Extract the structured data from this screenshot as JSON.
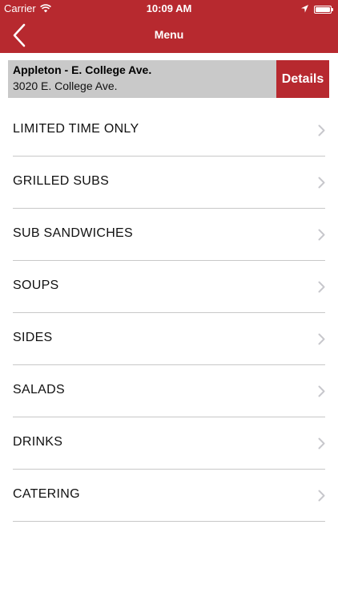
{
  "status_bar": {
    "carrier": "Carrier",
    "time": "10:09 AM",
    "wifi_icon": "wifi-icon",
    "location_icon": "location-arrow-icon",
    "battery_icon": "battery-icon"
  },
  "nav_bar": {
    "title": "Menu",
    "back_icon": "chevron-left-icon"
  },
  "store": {
    "name": "Appleton - E. College Ave.",
    "address": "3020 E. College Ave.",
    "details_label": "Details"
  },
  "menu": {
    "items": [
      {
        "label": "LIMITED TIME ONLY"
      },
      {
        "label": "GRILLED SUBS"
      },
      {
        "label": "SUB SANDWICHES"
      },
      {
        "label": "SOUPS"
      },
      {
        "label": "SIDES"
      },
      {
        "label": "SALADS"
      },
      {
        "label": "DRINKS"
      },
      {
        "label": "CATERING"
      }
    ]
  },
  "colors": {
    "brand_red": "#b7292f",
    "banner_gray": "#c9c9c9",
    "divider": "#c8c8c8",
    "chevron": "#c7c7cc"
  }
}
